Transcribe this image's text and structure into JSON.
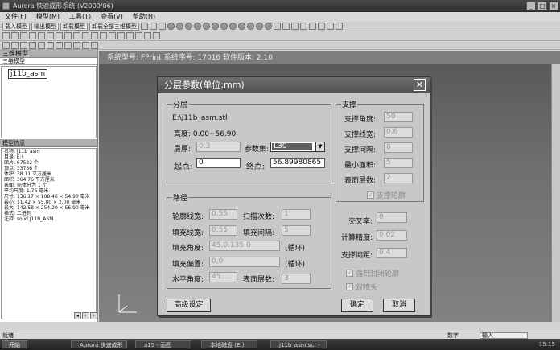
{
  "window": {
    "title": "Aurora 快速成形系统 (V2009/06)"
  },
  "menu": [
    "文件(F)",
    "模型(M)",
    "工具(T)",
    "查看(V)",
    "帮助(H)"
  ],
  "toolbar": {
    "load_model": "载入模型",
    "export_model": "输出模型",
    "unload_model": "卸载模型",
    "unload_all": "卸载全部三维模型"
  },
  "left_panel": {
    "title": "三维模型",
    "tab_label": "三维模型",
    "tree_item": "j11b_asm",
    "info_title": "模型信息",
    "info_lines": [
      "名称: j11b_asm",
      "目录: E:\\",
      "面片: 67522 个",
      "顶点: 33736 个",
      "体积: 38.11 立方厘米",
      "面积: 364.76 平方厘米",
      "表面: 壳体分为 1 个",
      "平均尺度: 1.76 毫米",
      "尺寸: 136.17 × 108.40 × 54.90 毫米",
      "最小: 11.42 × 55.80 × 2.00 毫米",
      "最大: 142.58 × 254.20 × 56.90 毫米",
      "格式: 二进制",
      "注释: solid J11B_ASM"
    ]
  },
  "info_bar": {
    "text": "系统型号: FPrint  系统序号: 17016  软件版本: 2.10"
  },
  "dialog": {
    "title": "分层参数(单位:mm)",
    "close": "✕",
    "layering": {
      "legend": "分层",
      "path": "E:\\j11b_asm.stl",
      "height_label": "高度: 0.00~56.90",
      "thickness_label": "层厚:",
      "thickness_value": "0.3",
      "param_set_label": "参数集:",
      "param_set_value": "L30",
      "start_label": "起点:",
      "start_value": "0",
      "end_label": "终点:",
      "end_value": "56.89980865"
    },
    "path": {
      "legend": "路径",
      "contour_width_label": "轮廓线宽:",
      "contour_width_value": "0.55",
      "scan_count_label": "扫描次数:",
      "scan_count_value": "1",
      "fill_width_label": "填充线宽:",
      "fill_width_value": "0.55",
      "fill_interval_label": "填充间隔:",
      "fill_interval_value": "5",
      "fill_angle_label": "填充角度:",
      "fill_angle_value": "45.0,135.0",
      "cycle1": "(循环)",
      "fill_offset_label": "填充偏置:",
      "fill_offset_value": "0,0",
      "cycle2": "(循环)",
      "horizontal_angle_label": "水平角度:",
      "horizontal_angle_value": "45",
      "surface_layers_label": "表面层数:",
      "surface_layers_value": "3"
    },
    "support": {
      "legend": "支撑",
      "angle_label": "支撑角度:",
      "angle_value": "50",
      "width_label": "支撑线宽:",
      "width_value": "0.6",
      "interval_label": "支撑间隔:",
      "interval_value": "8",
      "min_area_label": "最小面积:",
      "min_area_value": "5",
      "surface_layers_label": "表面层数:",
      "surface_layers_value": "2",
      "outline_check": "支撑轮廓"
    },
    "overlap_label": "交叉率:",
    "overlap_value": "0",
    "precision_label": "计算精度:",
    "precision_value": "0.02",
    "support_gap_label": "支撑间距:",
    "support_gap_value": "0.4",
    "seal_check": "强制封闭轮廓",
    "dual_nozzle_check": "双喷头",
    "advanced_button": "高级设定",
    "ok_button": "确定",
    "cancel_button": "取消"
  },
  "status": {
    "left": "就绪",
    "mid": "数字",
    "input": "输入"
  },
  "taskbar": {
    "start": "开始",
    "tasks": [
      "Aurora 快速成形",
      "a15 - 画图",
      "本地磁盘 (E:)",
      "j11b_asm.scr -"
    ],
    "clock": "15:15"
  }
}
